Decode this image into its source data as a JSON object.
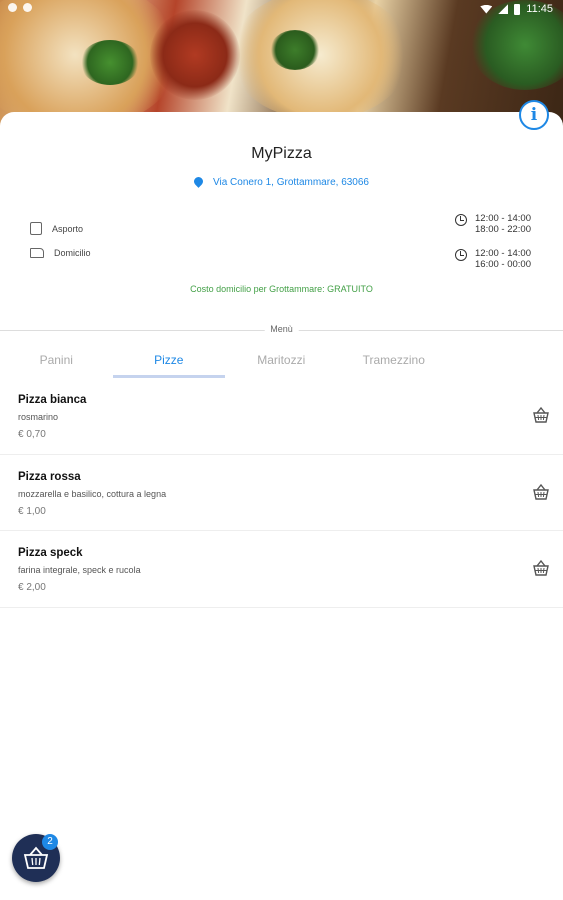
{
  "status_bar": {
    "time": "11:45"
  },
  "restaurant": {
    "name": "MyPizza",
    "address": "Via Conero 1, Grottammare, 63066",
    "services": [
      {
        "label": "Asporto",
        "icon": "receipt-icon"
      },
      {
        "label": "Domicilio",
        "icon": "delivery-truck-icon"
      }
    ],
    "hours": [
      {
        "line1": "12:00 - 14:00",
        "line2": "18:00 - 22:00"
      },
      {
        "line1": "12:00 - 14:00",
        "line2": "16:00 - 00:00"
      }
    ],
    "delivery_note": "Costo domicilio per Grottammare: GRATUITO"
  },
  "menu": {
    "label": "Menù",
    "tabs": [
      "Panini",
      "Pizze",
      "Maritozzi",
      "Tramezzino"
    ],
    "active_tab": "Pizze",
    "items": [
      {
        "name": "Pizza bianca",
        "description": "rosmarino",
        "price": "€ 0,70"
      },
      {
        "name": "Pizza rossa",
        "description": "mozzarella e basilico, cottura a legna",
        "price": "€ 1,00"
      },
      {
        "name": "Pizza speck",
        "description": "farina integrale, speck e rucola",
        "price": "€ 2,00"
      }
    ]
  },
  "cart": {
    "count": "2"
  },
  "colors": {
    "accent": "#1e88e5",
    "green": "#43a047",
    "fab": "#1f2f56"
  }
}
